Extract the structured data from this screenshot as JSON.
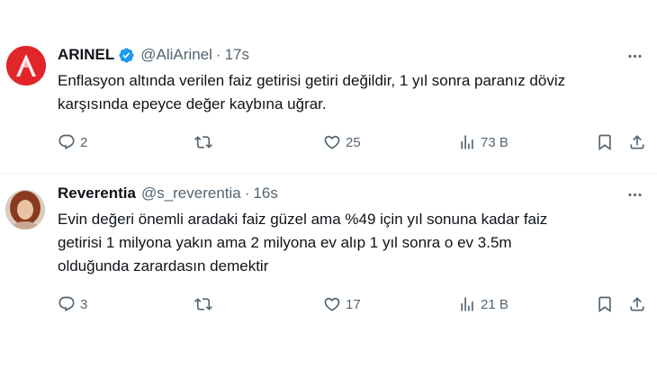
{
  "tweets": [
    {
      "display_name": "ARINEL",
      "verified": true,
      "handle": "@AliArinel",
      "separator": "·",
      "time": "17s",
      "text_lines": [
        "Enflasyon altında verilen faiz getirisi getiri değildir, 1 yıl sonra paranız döviz",
        "karşısında epeyce değer kaybına uğrar."
      ],
      "replies": "2",
      "retweets": "",
      "likes": "25",
      "views": "73 B"
    },
    {
      "display_name": "Reverentia",
      "verified": false,
      "handle": "@s_reverentia",
      "separator": "·",
      "time": "16s",
      "text_lines": [
        "Evin değeri önemli aradaki faiz güzel ama %49 için yıl sonuna kadar faiz",
        "getirisi 1 milyona yakın ama 2 milyona ev alıp 1 yıl sonra o ev 3.5m",
        "olduğunda zarardasın demektir"
      ],
      "replies": "3",
      "retweets": "",
      "likes": "17",
      "views": "21 B"
    }
  ],
  "colors": {
    "text": "#0f1419",
    "secondary": "#536471",
    "verified": "#1d9bf0",
    "divider": "#eff3f4",
    "avatar1": "#e0262b"
  },
  "icons": [
    "reply-icon",
    "retweet-icon",
    "like-icon",
    "views-icon",
    "bookmark-icon",
    "share-icon",
    "more-icon",
    "verified-badge-icon"
  ]
}
